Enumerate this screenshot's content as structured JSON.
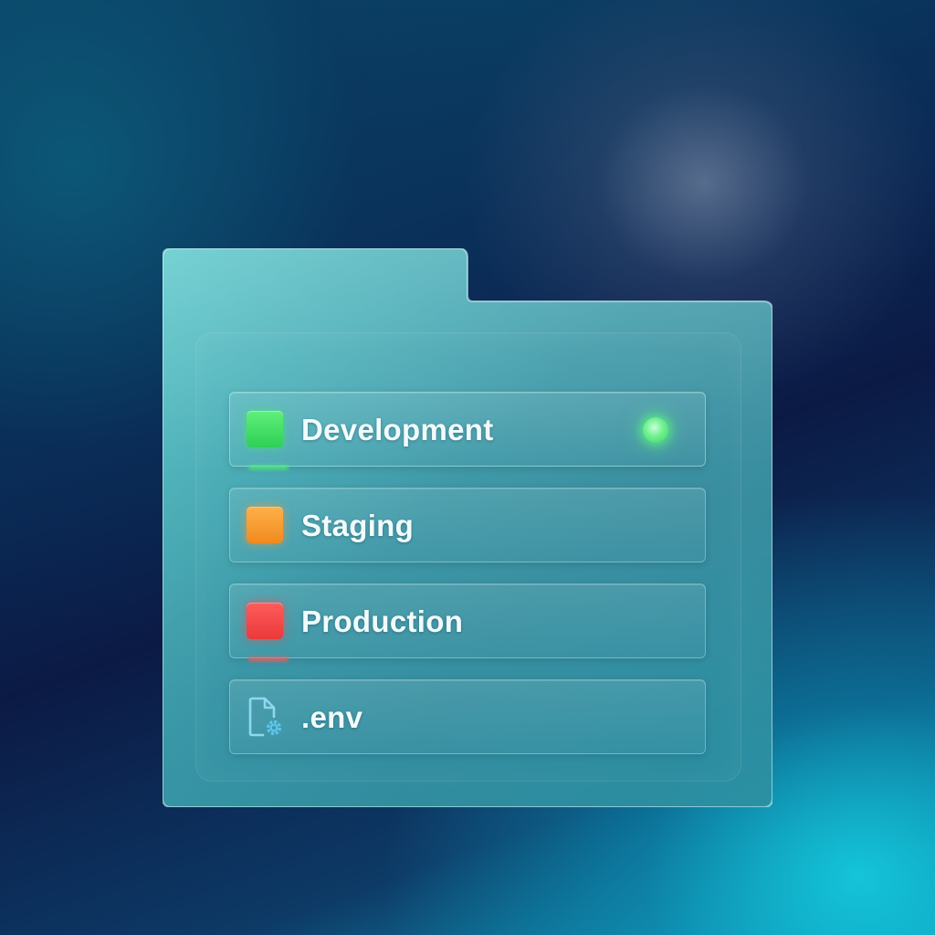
{
  "folder": {
    "items": [
      {
        "label": "Development",
        "status_color": "#3fdc66",
        "icon": "green-square",
        "active": true
      },
      {
        "label": "Staging",
        "status_color": "#f79a2c",
        "icon": "orange-square",
        "active": false
      },
      {
        "label": "Production",
        "status_color": "#f04a4a",
        "icon": "red-square",
        "active": false
      },
      {
        "label": ".env",
        "icon": "file-settings-icon",
        "active": false
      }
    ],
    "active_indicator_color": "#6ef08f"
  }
}
